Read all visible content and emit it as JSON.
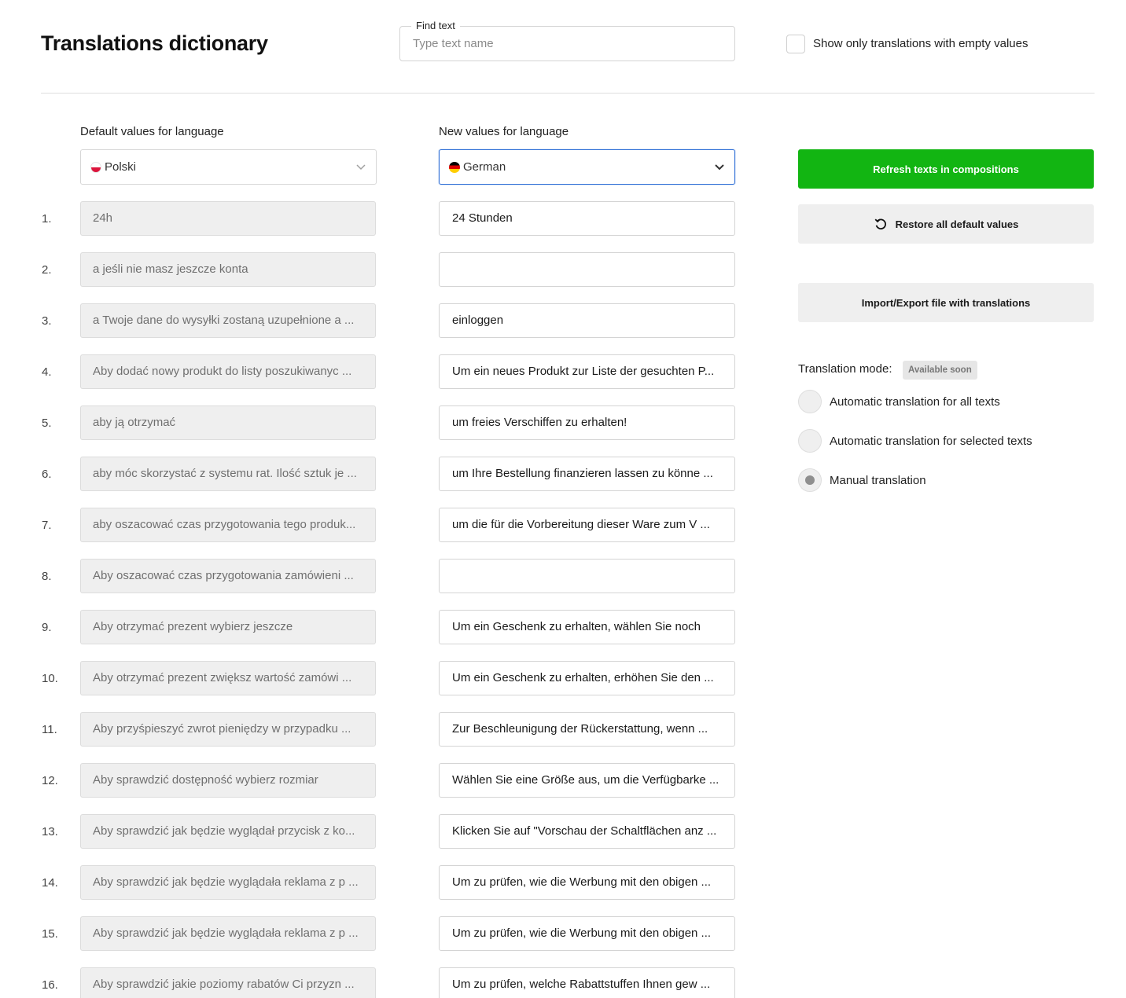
{
  "header": {
    "title": "Translations dictionary",
    "find_label": "Find text",
    "find_placeholder": "Type text name",
    "empty_filter_label": "Show only translations with empty values"
  },
  "columns": {
    "default_label": "Default values for language",
    "new_label": "New values for language",
    "default_language": "Polski",
    "new_language": "German"
  },
  "rows": [
    {
      "num": "1.",
      "default": "24h",
      "value": "24 Stunden"
    },
    {
      "num": "2.",
      "default": "a jeśli nie masz jeszcze konta",
      "value": ""
    },
    {
      "num": "3.",
      "default": "a Twoje dane do wysyłki zostaną uzupełnione a  ...",
      "value": "einloggen"
    },
    {
      "num": "4.",
      "default": "Aby dodać nowy produkt do listy poszukiwanyc ...",
      "value": "Um ein neues Produkt zur Liste der gesuchten P..."
    },
    {
      "num": "5.",
      "default": "aby ją otrzymać",
      "value": "um freies Verschiffen zu erhalten!"
    },
    {
      "num": "6.",
      "default": "aby móc skorzystać z systemu rat. Ilość sztuk je  ...",
      "value": "um Ihre Bestellung finanzieren lassen zu könne  ..."
    },
    {
      "num": "7.",
      "default": "aby oszacować czas przygotowania tego produk...",
      "value": "um die für die Vorbereitung dieser Ware zum V  ..."
    },
    {
      "num": "8.",
      "default": "Aby oszacować czas przygotowania zamówieni  ...",
      "value": ""
    },
    {
      "num": "9.",
      "default": "Aby otrzymać prezent wybierz jeszcze",
      "value": "Um ein Geschenk zu erhalten, wählen Sie noch"
    },
    {
      "num": "10.",
      "default": "Aby otrzymać prezent zwiększ wartość zamówi  ...",
      "value": "Um ein Geschenk zu erhalten, erhöhen Sie den  ..."
    },
    {
      "num": "11.",
      "default": "Aby przyśpieszyć zwrot pieniędzy w przypadku  ...",
      "value": "Zur Beschleunigung der Rückerstattung, wenn  ..."
    },
    {
      "num": "12.",
      "default": "Aby sprawdzić dostępność wybierz rozmiar",
      "value": "Wählen Sie eine Größe aus, um die Verfügbarke ..."
    },
    {
      "num": "13.",
      "default": "Aby sprawdzić jak będzie wyglądał przycisk z ko...",
      "value": "Klicken Sie auf \"Vorschau der Schaltflächen anz  ..."
    },
    {
      "num": "14.",
      "default": "Aby sprawdzić jak będzie wyglądała reklama z p ...",
      "value": "Um zu prüfen, wie die Werbung mit den obigen  ..."
    },
    {
      "num": "15.",
      "default": "Aby sprawdzić jak będzie wyglądała reklama z p ...",
      "value": "Um zu prüfen, wie die Werbung mit den obigen  ..."
    },
    {
      "num": "16.",
      "default": "Aby sprawdzić jakie poziomy rabatów Ci przyzn ...",
      "value": "Um zu prüfen, welche Rabattstuffen Ihnen gew  ..."
    }
  ],
  "actions": {
    "refresh": "Refresh texts in compositions",
    "restore": "Restore all default values",
    "import_export": "Import/Export file with translations"
  },
  "mode": {
    "label": "Translation mode:",
    "badge": "Available soon",
    "options": [
      {
        "label": "Automatic translation for all texts",
        "checked": false
      },
      {
        "label": "Automatic translation for selected texts",
        "checked": false
      },
      {
        "label": "Manual translation",
        "checked": true
      }
    ]
  },
  "colors": {
    "accent_green": "#12b512",
    "focus_blue": "#2f6fd6",
    "button_grey": "#efefef"
  }
}
